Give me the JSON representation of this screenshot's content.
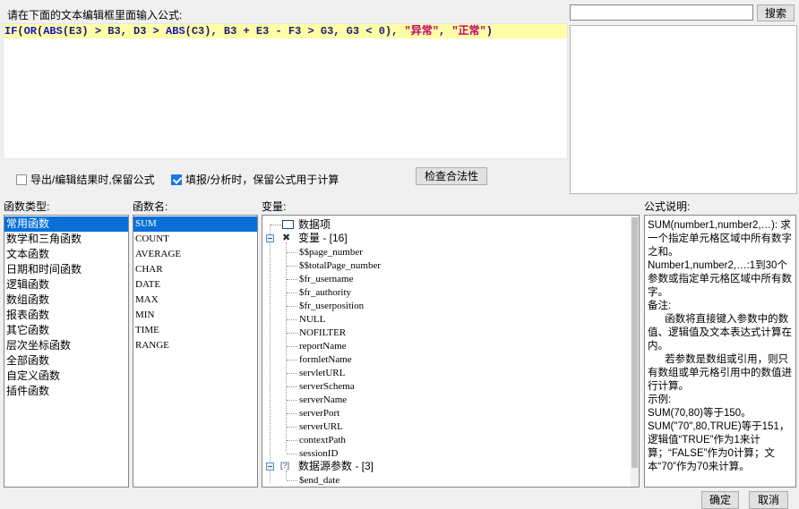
{
  "editor": {
    "prompt": "请在下面的文本编辑框里面输入公式:",
    "formula_tokens": [
      {
        "t": "IF",
        "c": "kw"
      },
      {
        "t": "(",
        "c": "op"
      },
      {
        "t": "OR",
        "c": "kw"
      },
      {
        "t": "(",
        "c": "op"
      },
      {
        "t": "ABS",
        "c": "kw"
      },
      {
        "t": "(E3) > B3, D3 > ",
        "c": "op"
      },
      {
        "t": "ABS",
        "c": "kw"
      },
      {
        "t": "(C3), B3 + E3 - F3 > G3, G3 < 0), ",
        "c": "op"
      },
      {
        "t": "\"异常\"",
        "c": "str"
      },
      {
        "t": ", ",
        "c": "op"
      },
      {
        "t": "\"正常\"",
        "c": "str"
      },
      {
        "t": ")",
        "c": "op"
      }
    ]
  },
  "search": {
    "value": "",
    "button_label": "搜索"
  },
  "options": {
    "export_keep_formula": {
      "label": "导出/编辑结果时,保留公式",
      "checked": false
    },
    "fill_keep_formula": {
      "label": "填报/分析时，保留公式用于计算",
      "checked": true
    },
    "check_button": "检查合法性"
  },
  "function_types": {
    "header": "函数类型:",
    "items": [
      "常用函数",
      "数学和三角函数",
      "文本函数",
      "日期和时间函数",
      "逻辑函数",
      "数组函数",
      "报表函数",
      "其它函数",
      "层次坐标函数",
      "全部函数",
      "自定义函数",
      "插件函数"
    ],
    "selected": 0
  },
  "function_names": {
    "header": "函数名:",
    "items": [
      "SUM",
      "COUNT",
      "AVERAGE",
      "CHAR",
      "DATE",
      "MAX",
      "MIN",
      "TIME",
      "RANGE"
    ],
    "selected": 0
  },
  "variables": {
    "header": "变量:",
    "root_data": "数据项",
    "group_vars": "变量 - [16]",
    "vars": [
      "$$page_number",
      "$$totalPage_number",
      "$fr_username",
      "$fr_authority",
      "$fr_userposition",
      "NULL",
      "NOFILTER",
      "reportName",
      "formletName",
      "servletURL",
      "serverSchema",
      "serverName",
      "serverPort",
      "serverURL",
      "contextPath",
      "sessionID"
    ],
    "group_params": "数据源参数 - [3]",
    "params": [
      "$end_date"
    ]
  },
  "description": {
    "header": "公式说明:",
    "text": "SUM(number1,number2,…): 求一个指定单元格区域中所有数字之和。\nNumber1,number2,…:1到30个参数或指定单元格区域中所有数字。\n备注:\n      函数将直接键入参数中的数值、逻辑值及文本表达式计算在内。\n      若参数是数组或引用，则只有数组或单元格引用中的数值进行计算。\n示例:\nSUM(70,80)等于150。\nSUM(\"70\",80,TRUE)等于151，逻辑值“TRUE”作为1来计算；“FALSE”作为0计算；文本“70”作为70来计算。"
  },
  "footer": {
    "ok": "确定",
    "cancel": "取消"
  }
}
